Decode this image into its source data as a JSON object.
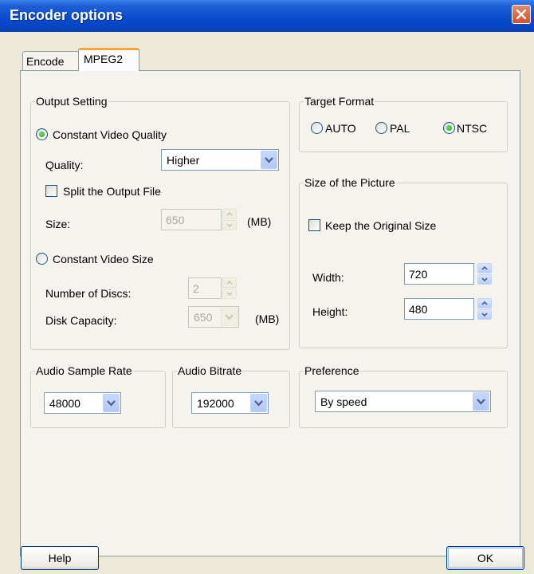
{
  "window": {
    "title": "Encoder options"
  },
  "tabs": [
    {
      "label": "Encode"
    },
    {
      "label": "MPEG2"
    }
  ],
  "output_setting": {
    "title": "Output Setting",
    "constant_quality_label": "Constant Video Quality",
    "quality_label": "Quality:",
    "quality_value": "Higher",
    "split_label": "Split the Output File",
    "size_label": "Size:",
    "size_value": "650",
    "size_unit": "(MB)",
    "constant_size_label": "Constant Video Size",
    "discs_label": "Number of Discs:",
    "discs_value": "2",
    "capacity_label": "Disk Capacity:",
    "capacity_value": "650",
    "capacity_unit": "(MB)"
  },
  "target_format": {
    "title": "Target Format",
    "options": [
      {
        "label": "AUTO"
      },
      {
        "label": "PAL"
      },
      {
        "label": "NTSC"
      }
    ],
    "selected": "NTSC"
  },
  "picture_size": {
    "title": "Size of the Picture",
    "keep_label": "Keep the Original Size",
    "width_label": "Width:",
    "width_value": "720",
    "height_label": "Height:",
    "height_value": "480"
  },
  "audio_sample_rate": {
    "title": "Audio Sample Rate",
    "value": "48000"
  },
  "audio_bitrate": {
    "title": "Audio Bitrate",
    "value": "192000"
  },
  "preference": {
    "title": "Preference",
    "value": "By speed"
  },
  "buttons": {
    "help": "Help",
    "ok": "OK"
  }
}
